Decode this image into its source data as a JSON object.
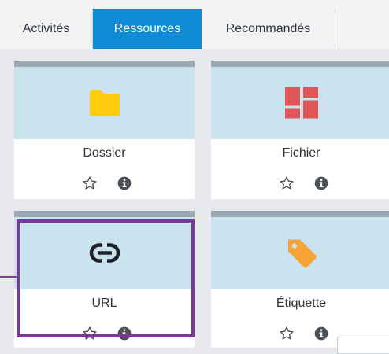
{
  "tabs": [
    {
      "label": "Activités",
      "active": false
    },
    {
      "label": "Ressources",
      "active": true
    },
    {
      "label": "Recommandés",
      "active": false
    }
  ],
  "modules": [
    {
      "label": "Dossier",
      "icon": "folder-icon",
      "icon_color": "#ffcb0f"
    },
    {
      "label": "Fichier",
      "icon": "file-grid-icon",
      "icon_color": "#e05556"
    },
    {
      "label": "URL",
      "icon": "link-icon",
      "icon_color": "#1d2125",
      "highlighted": true
    },
    {
      "label": "Étiquette",
      "icon": "tag-icon",
      "icon_color": "#f7a234"
    }
  ],
  "colors": {
    "active_tab": "#0f8ad3",
    "highlight": "#7b3a9a",
    "card_band": "#c9e3ef",
    "card_topbar": "#9ca8b1"
  }
}
